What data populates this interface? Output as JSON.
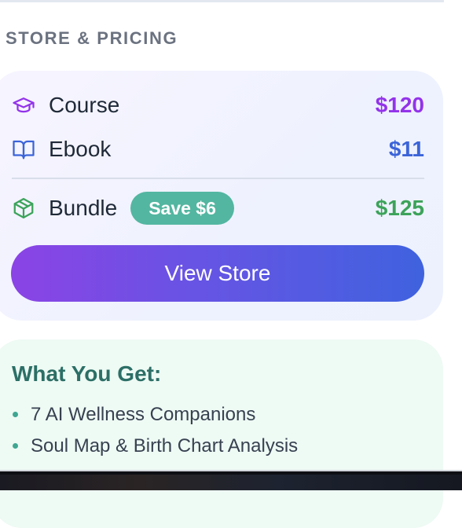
{
  "section": {
    "title": "STORE & PRICING"
  },
  "pricing": {
    "items": [
      {
        "icon": "graduation-cap-icon",
        "label": "Course",
        "price": "$120",
        "color": "#9333ea"
      },
      {
        "icon": "book-open-icon",
        "label": "Ebook",
        "price": "$11",
        "color": "#3b64d8"
      },
      {
        "icon": "package-icon",
        "label": "Bundle",
        "price": "$125",
        "badge": "Save $6",
        "color": "#3ca35a"
      }
    ],
    "cta_label": "View Store"
  },
  "benefits": {
    "heading": "What You Get:",
    "items": [
      "7 AI Wellness Companions",
      "Soul Map & Birth Chart Analysis"
    ]
  },
  "colors": {
    "course": "#9333ea",
    "ebook": "#3b64d8",
    "bundle": "#3ca35a",
    "badge": "#53b6a0",
    "heading": "#2c6f66"
  }
}
